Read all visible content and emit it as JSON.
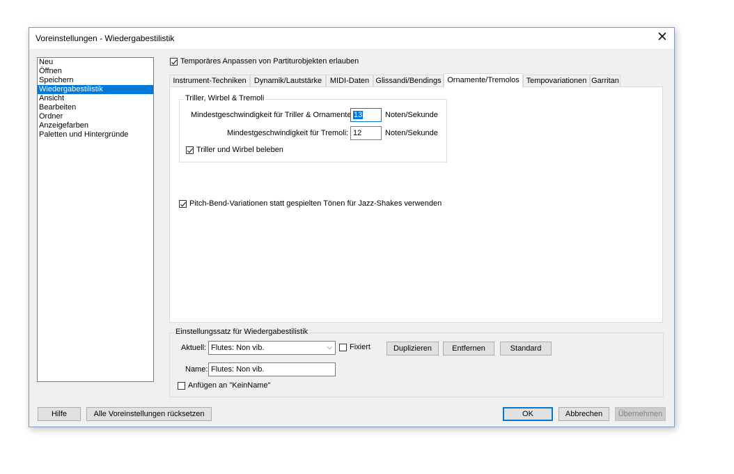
{
  "window": {
    "title": "Voreinstellungen - Wiedergabestilistik",
    "close_symbol": "✕"
  },
  "categories": [
    {
      "label": "Neu",
      "selected": false
    },
    {
      "label": "Öffnen",
      "selected": false
    },
    {
      "label": "Speichern",
      "selected": false
    },
    {
      "label": "Wiedergabestilistik",
      "selected": true
    },
    {
      "label": "Ansicht",
      "selected": false
    },
    {
      "label": "Bearbeiten",
      "selected": false
    },
    {
      "label": "Ordner",
      "selected": false
    },
    {
      "label": "Anzeigefarben",
      "selected": false
    },
    {
      "label": "Paletten und Hintergründe",
      "selected": false
    }
  ],
  "top_option": {
    "label": "Temporäres Anpassen von Partiturobjekten erlauben",
    "checked": true
  },
  "tabs": [
    {
      "label": "Instrument-Techniken",
      "active": false
    },
    {
      "label": "Dynamik/Lautstärke",
      "active": false
    },
    {
      "label": "MIDI-Daten",
      "active": false
    },
    {
      "label": "Glissandi/Bendings",
      "active": false
    },
    {
      "label": "Ornamente/Tremolos",
      "active": true
    },
    {
      "label": "Tempovariationen",
      "active": false
    },
    {
      "label": "Garritan",
      "active": false
    }
  ],
  "ornaments": {
    "group_title": "Triller, Wirbel & Tremoli",
    "trill_speed_label": "Mindestgeschwindigkeit für Triller & Ornamente:",
    "trill_speed_value": "13",
    "trill_speed_unit": "Noten/Sekunde",
    "tremolo_speed_label": "Mindestgeschwindigkeit für Tremoli:",
    "tremolo_speed_value": "12",
    "tremolo_speed_unit": "Noten/Sekunde",
    "animate_label": "Triller und Wirbel beleben",
    "animate_checked": true,
    "pitchbend_label": "Pitch-Bend-Variationen statt gespielten Tönen für Jazz-Shakes verwenden",
    "pitchbend_checked": true
  },
  "preset": {
    "group_title": "Einstellungssatz für Wiedergabestilistik",
    "current_label": "Aktuell:",
    "current_value": "Flutes: Non vib.",
    "fixed_label": "Fixiert",
    "fixed_checked": false,
    "duplicate_label": "Duplizieren",
    "remove_label": "Entfernen",
    "standard_label": "Standard",
    "name_label": "Name:",
    "name_value": "Flutes: Non vib.",
    "append_label": "Anfügen an \"KeinName\"",
    "append_checked": false
  },
  "footer": {
    "help_label": "Hilfe",
    "reset_label": "Alle Voreinstellungen rücksetzen",
    "ok_label": "OK",
    "cancel_label": "Abbrechen",
    "apply_label": "Übernehmen"
  },
  "colors": {
    "accent": "#0078d7",
    "dialog_bg": "#f0f0f0",
    "panel_bg": "#ffffff"
  }
}
